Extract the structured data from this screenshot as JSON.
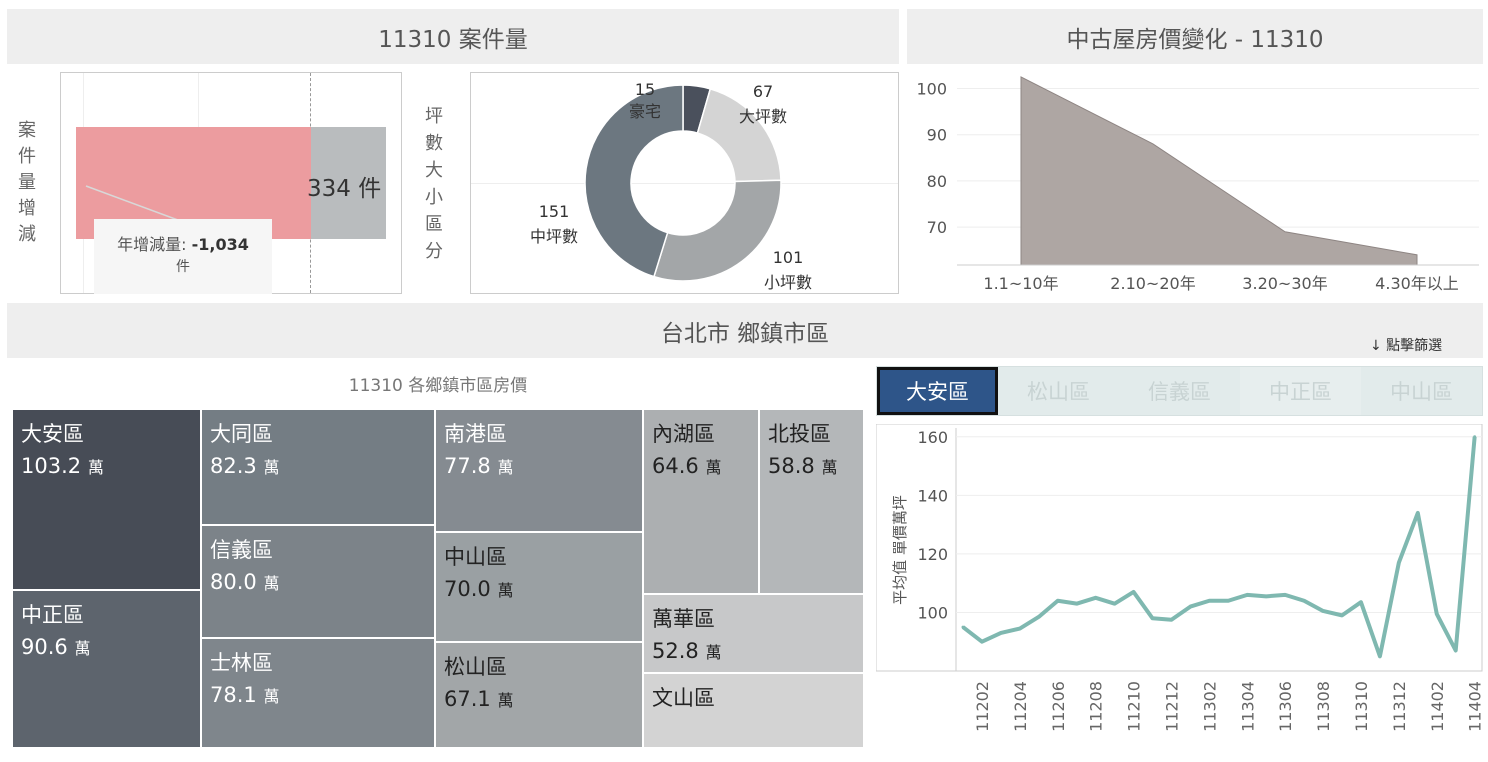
{
  "headers": {
    "case_volume": "11310 案件量",
    "price_change": "中古屋房價變化 - 11310",
    "city": "台北市 鄉鎮市區"
  },
  "bar_panel": {
    "vertical_label": "案件量增減",
    "value_text": "334 件",
    "tooltip_label": "年增減量: ",
    "tooltip_value": "-1,034",
    "tooltip_unit": "件"
  },
  "donut_panel": {
    "vertical_label": "坪數大小區分",
    "segments": [
      {
        "label": "豪宅",
        "value": "15",
        "color": "#4a505c"
      },
      {
        "label": "大坪數",
        "value": "67",
        "color": "#d4d4d4"
      },
      {
        "label": "小坪數",
        "value": "101",
        "color": "#a3a6a8"
      },
      {
        "label": "中坪數",
        "value": "151",
        "color": "#6c7780"
      }
    ]
  },
  "area_chart": {
    "y_ticks": [
      "100",
      "90",
      "80",
      "70"
    ],
    "x_labels": [
      "1.1~10年",
      "2.10~20年",
      "3.20~30年",
      "4.30年以上"
    ],
    "values": [
      102.5,
      88,
      69,
      64
    ]
  },
  "treemap": {
    "title": "11310 各鄉鎮市區房價",
    "unit": "萬",
    "cells": [
      {
        "name": "大安區",
        "value": "103.2",
        "color": "#474c56",
        "text": "#ffffff"
      },
      {
        "name": "中正區",
        "value": "90.6",
        "color": "#5d646d",
        "text": "#ffffff"
      },
      {
        "name": "大同區",
        "value": "82.3",
        "color": "#747d84",
        "text": "#ffffff"
      },
      {
        "name": "信義區",
        "value": "80.0",
        "color": "#7c8389",
        "text": "#ffffff"
      },
      {
        "name": "士林區",
        "value": "78.1",
        "color": "#7f868c",
        "text": "#ffffff"
      },
      {
        "name": "南港區",
        "value": "77.8",
        "color": "#858b91",
        "text": "#ffffff"
      },
      {
        "name": "中山區",
        "value": "70.0",
        "color": "#9aa0a3",
        "text": "#222222"
      },
      {
        "name": "松山區",
        "value": "67.1",
        "color": "#a2a6a8",
        "text": "#222222"
      },
      {
        "name": "內湖區",
        "value": "64.6",
        "color": "#acafb1",
        "text": "#222222"
      },
      {
        "name": "北投區",
        "value": "58.8",
        "color": "#b4b7b9",
        "text": "#222222"
      },
      {
        "name": "萬華區",
        "value": "52.8",
        "color": "#c7c8c9",
        "text": "#222222"
      },
      {
        "name": "文山區",
        "value": "",
        "color": "#d3d3d3",
        "text": "#222222"
      }
    ]
  },
  "filter": {
    "hint": "↓ 點擊篩選",
    "tabs": [
      "大安區",
      "松山區",
      "信義區",
      "中正區",
      "中山區"
    ],
    "selected": "大安區"
  },
  "chart_data": {
    "type": "line",
    "ylabel": "平均值 單價萬坪",
    "y_ticks": [
      "160",
      "140",
      "120",
      "100"
    ],
    "x_tick_labels": [
      "11202",
      "11204",
      "11206",
      "11208",
      "11210",
      "11212",
      "11302",
      "11304",
      "11306",
      "11308",
      "11310",
      "11312",
      "11402",
      "11404"
    ],
    "x": [
      "11201",
      "11202",
      "11203",
      "11204",
      "11205",
      "11206",
      "11207",
      "11208",
      "11209",
      "11210",
      "11211",
      "11212",
      "11301",
      "11302",
      "11303",
      "11304",
      "11305",
      "11306",
      "11307",
      "11308",
      "11309",
      "11310",
      "11311",
      "11312",
      "11401",
      "11402",
      "11403",
      "11404"
    ],
    "values": [
      95,
      90,
      93,
      94.5,
      98.5,
      104,
      103,
      105,
      103,
      107,
      98,
      97.5,
      102,
      104,
      104,
      106,
      105.5,
      106,
      104,
      100.5,
      99,
      103.5,
      85,
      117,
      134,
      99.5,
      87,
      160
    ],
    "ylim": [
      80,
      163
    ],
    "color": "#7fb8b0"
  }
}
